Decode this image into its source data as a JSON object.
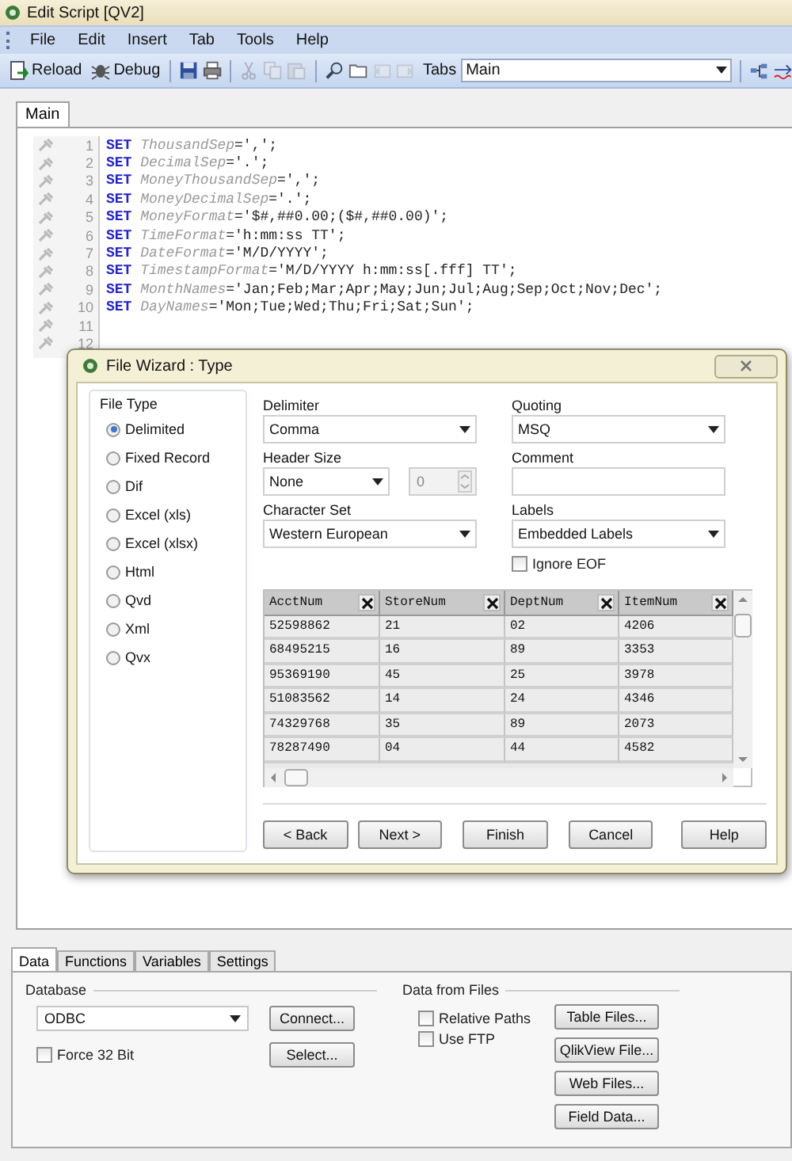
{
  "window": {
    "title": "Edit Script [QV2]"
  },
  "menu": [
    "File",
    "Edit",
    "Insert",
    "Tab",
    "Tools",
    "Help"
  ],
  "toolbar": {
    "items": [
      {
        "kind": "reload",
        "label": "Reload",
        "disabled": false
      },
      {
        "kind": "debug",
        "label": "Debug",
        "disabled": false
      },
      {
        "kind": "sep"
      },
      {
        "kind": "save",
        "disabled": false
      },
      {
        "kind": "print",
        "disabled": false
      },
      {
        "kind": "sep"
      },
      {
        "kind": "cut",
        "disabled": true
      },
      {
        "kind": "copy",
        "disabled": true
      },
      {
        "kind": "paste",
        "disabled": true
      },
      {
        "kind": "sep"
      },
      {
        "kind": "find",
        "disabled": false
      },
      {
        "kind": "folder",
        "disabled": false
      },
      {
        "kind": "tab-left",
        "disabled": true
      },
      {
        "kind": "tab-right",
        "disabled": true
      }
    ],
    "tabs_label": "Tabs",
    "tabs_value": "Main",
    "right_items": [
      {
        "kind": "tree",
        "disabled": false
      },
      {
        "kind": "marker",
        "disabled": false
      }
    ]
  },
  "editor": {
    "tabs": [
      {
        "label": "Main",
        "selected": true
      }
    ],
    "lines": [
      {
        "number": "1",
        "keyword": "SET",
        "variable": "ThousandSep",
        "value": "=',';"
      },
      {
        "number": "2",
        "keyword": "SET",
        "variable": "DecimalSep",
        "value": "='.';"
      },
      {
        "number": "3",
        "keyword": "SET",
        "variable": "MoneyThousandSep",
        "value": "=',';"
      },
      {
        "number": "4",
        "keyword": "SET",
        "variable": "MoneyDecimalSep",
        "value": "='.';"
      },
      {
        "number": "5",
        "keyword": "SET",
        "variable": "MoneyFormat",
        "value": "='$#,##0.00;($#,##0.00)';"
      },
      {
        "number": "6",
        "keyword": "SET",
        "variable": "TimeFormat",
        "value": "='h:mm:ss TT';"
      },
      {
        "number": "7",
        "keyword": "SET",
        "variable": "DateFormat",
        "value": "='M/D/YYYY';"
      },
      {
        "number": "8",
        "keyword": "SET",
        "variable": "TimestampFormat",
        "value": "='M/D/YYYY h:mm:ss[.fff] TT';"
      },
      {
        "number": "9",
        "keyword": "SET",
        "variable": "MonthNames",
        "value": "='Jan;Feb;Mar;Apr;May;Jun;Jul;Aug;Sep;Oct;Nov;Dec';"
      },
      {
        "number": "10",
        "keyword": "SET",
        "variable": "DayNames",
        "value": "='Mon;Tue;Wed;Thu;Fri;Sat;Sun';"
      },
      {
        "number": "11"
      },
      {
        "number": "12"
      }
    ]
  },
  "dialog": {
    "title": "File Wizard : Type",
    "file_type": {
      "legend": "File Type",
      "options": [
        {
          "label": "Delimited",
          "selected": true
        },
        {
          "label": "Fixed Record",
          "selected": false
        },
        {
          "label": "Dif",
          "selected": false
        },
        {
          "label": "Excel (xls)",
          "selected": false
        },
        {
          "label": "Excel (xlsx)",
          "selected": false
        },
        {
          "label": "Html",
          "selected": false
        },
        {
          "label": "Qvd",
          "selected": false
        },
        {
          "label": "Xml",
          "selected": false
        },
        {
          "label": "Qvx",
          "selected": false
        }
      ]
    },
    "delimiter": {
      "label": "Delimiter",
      "value": "Comma"
    },
    "quoting": {
      "label": "Quoting",
      "value": "MSQ"
    },
    "header_size": {
      "label": "Header Size",
      "value": "None",
      "count": "0",
      "count_disabled": true
    },
    "comment": {
      "label": "Comment"
    },
    "character_set": {
      "label": "Character Set",
      "value": "Western European"
    },
    "labels": {
      "label": "Labels",
      "value": "Embedded Labels"
    },
    "ignore_eof": {
      "label": "Ignore EOF",
      "checked": false
    },
    "preview": {
      "columns": [
        "AcctNum",
        "StoreNum",
        "DeptNum",
        "ItemNum"
      ],
      "rows": [
        [
          "52598862",
          "21",
          "02",
          "4206"
        ],
        [
          "68495215",
          "16",
          "89",
          "3353"
        ],
        [
          "95369190",
          "45",
          "25",
          "3978"
        ],
        [
          "51083562",
          "14",
          "24",
          "4346"
        ],
        [
          "74329768",
          "35",
          "89",
          "2073"
        ],
        [
          "78287490",
          "04",
          "44",
          "4582"
        ]
      ]
    },
    "buttons": [
      "< Back",
      "Next >",
      "Finish",
      "Cancel",
      "Help"
    ]
  },
  "bottom": {
    "tabs": [
      {
        "label": "Data",
        "selected": true
      },
      {
        "label": "Functions",
        "selected": false
      },
      {
        "label": "Variables",
        "selected": false
      },
      {
        "label": "Settings",
        "selected": false
      }
    ],
    "database": {
      "legend": "Database",
      "value": "ODBC",
      "force32": {
        "label": "Force 32 Bit",
        "checked": false
      },
      "buttons": [
        "Connect...",
        "Select..."
      ]
    },
    "files": {
      "legend": "Data from Files",
      "checks": [
        {
          "label": "Relative Paths",
          "checked": false
        },
        {
          "label": "Use FTP",
          "checked": false
        }
      ],
      "buttons": [
        "Table Files...",
        "QlikView File...",
        "Web Files...",
        "Field Data..."
      ]
    }
  }
}
